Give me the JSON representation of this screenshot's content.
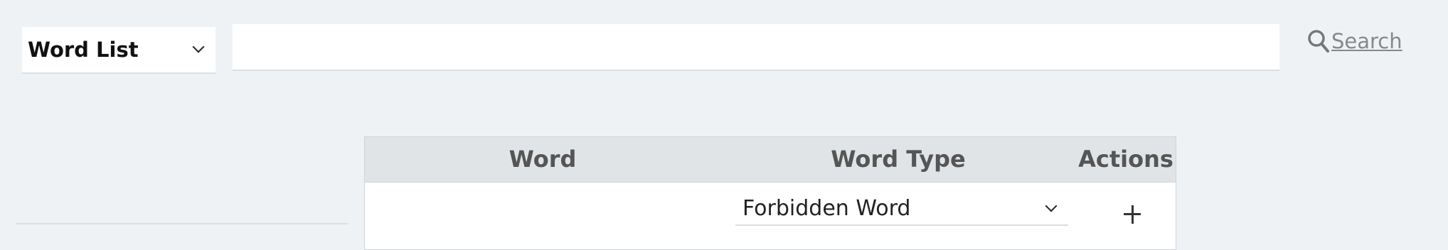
{
  "toolbar": {
    "list_select": {
      "selected": "Word List",
      "icon": "chevron-down-icon"
    },
    "search_input": {
      "value": "",
      "placeholder": ""
    },
    "search_link": {
      "label": "Search",
      "icon": "search-icon",
      "color": "#888888"
    }
  },
  "table": {
    "columns": [
      "Word",
      "Word Type",
      "Actions"
    ],
    "new_row": {
      "word_value": "",
      "word_type": "Forbidden Word",
      "action_icon": "plus-icon"
    }
  },
  "colors": {
    "background": "#eff2f5",
    "header_background": "#e1e4e7",
    "header_text": "#555555"
  }
}
